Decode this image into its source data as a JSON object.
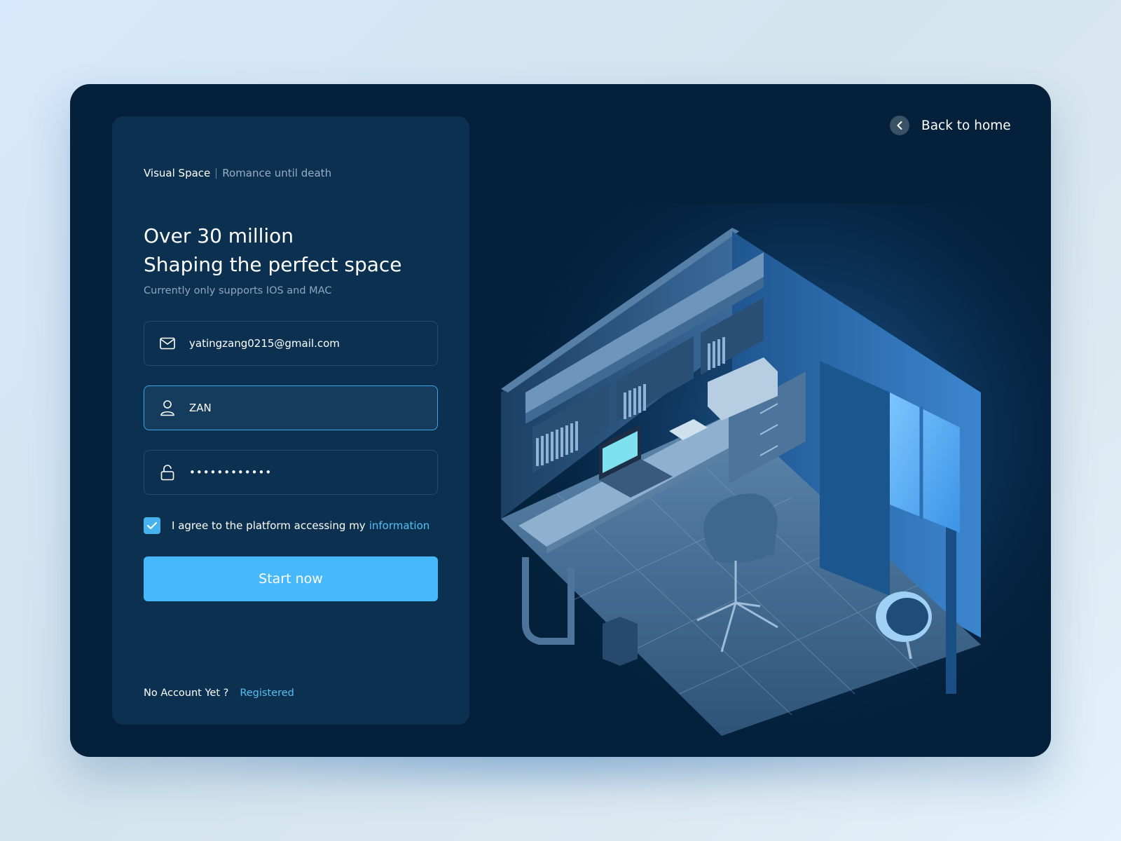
{
  "brand": {
    "name": "Visual Space",
    "tagline": "Romance until death"
  },
  "hero": {
    "title_line1": "Over 30 million",
    "title_line2": "Shaping the perfect space",
    "subtitle": "Currently only supports IOS and MAC"
  },
  "form": {
    "email": {
      "value": "yatingzang0215@gmail.com",
      "icon": "mail-icon"
    },
    "username": {
      "value": "ZAN",
      "icon": "user-icon"
    },
    "password": {
      "value": "••••••••••••",
      "icon": "lock-icon"
    },
    "agree": {
      "checked": true,
      "text": "I agree to the platform accessing my",
      "link": "information"
    },
    "submit_label": "Start now"
  },
  "footer": {
    "prompt": "No Account Yet ?",
    "link": "Registered"
  },
  "nav": {
    "back_label": "Back to home",
    "icon": "chevron-left-icon"
  },
  "colors": {
    "window_bg": "#04203a",
    "panel_bg": "#0c3150",
    "accent": "#47b8fb",
    "link": "#54c0f5",
    "focus_border": "#3aa7ec"
  }
}
